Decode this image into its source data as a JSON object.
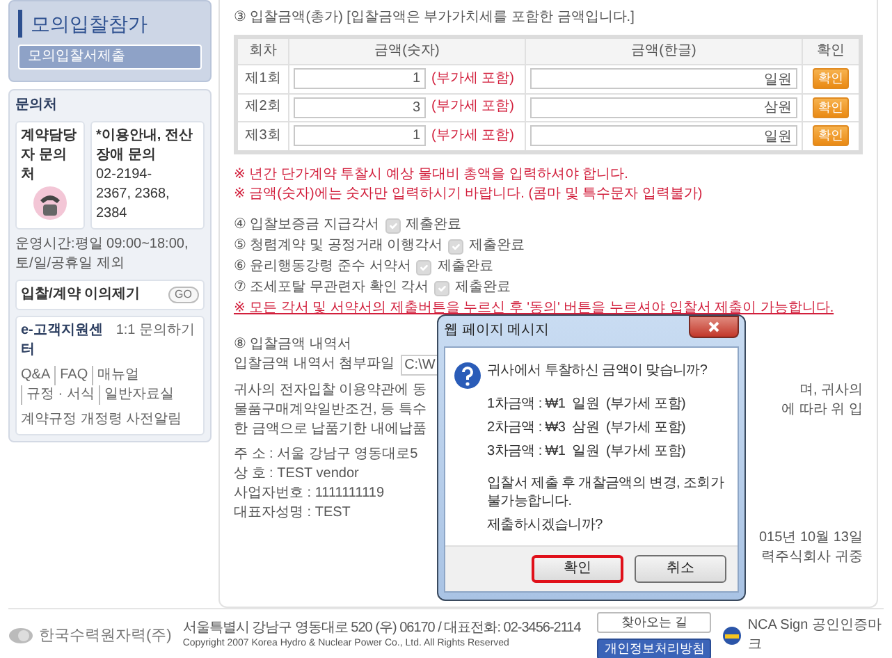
{
  "sidebar": {
    "menu": {
      "title": "모의입찰참가",
      "items": [
        {
          "label": "모의입찰서제출",
          "selected": true
        }
      ]
    },
    "contact": {
      "title": "문의처",
      "contract_contact": "계약담당자 문의처",
      "help_label": "*이용안내, 전산장애 문의",
      "phone_lines": [
        "02-2194-",
        "2367, 2368, 2384"
      ],
      "hours": "운영시간:평일 09:00~18:00, 토/일/공휴일 제외"
    },
    "objection": {
      "label": "입찰/계약 이의제기",
      "button": "GO"
    },
    "support": {
      "title": "e-고객지원센터",
      "inquiry": "1:1 문의하기",
      "link_rows": [
        [
          "Q&A",
          "FAQ",
          "매뉴얼",
          "규정 · 서식",
          "일반자료실"
        ],
        [
          "계약규정 개정령 사전알림"
        ]
      ]
    }
  },
  "main": {
    "bid_amount_heading": "③ 입찰금액(총가) [입찰금액은 부가가치세를 포함한 금액입니다.]",
    "table": {
      "columns": [
        "회차",
        "금액(숫자)",
        "금액(한글)",
        "확인"
      ],
      "rows": [
        {
          "round": "제1회",
          "amount": "1",
          "vat_note": "(부가세 포함)",
          "amount_korean": "일원",
          "button": "확인"
        },
        {
          "round": "제2회",
          "amount": "3",
          "vat_note": "(부가세 포함)",
          "amount_korean": "삼원",
          "button": "확인"
        },
        {
          "round": "제3회",
          "amount": "1",
          "vat_note": "(부가세 포함)",
          "amount_korean": "일원",
          "button": "확인"
        }
      ]
    },
    "notes": [
      "※ 년간 단가계약 투찰시 예상 물대비 총액을 입력하셔야 합니다.",
      "※ 금액(숫자)에는 숫자만 입력하시기 바랍니다. (콤마 및 특수문자 입력불가)"
    ],
    "declarations": [
      {
        "label": "④ 입찰보증금 지급각서",
        "checked": true,
        "status": "제출완료"
      },
      {
        "label": "⑤ 청렴계약 및 공정거래 이행각서",
        "checked": true,
        "status": "제출완료"
      },
      {
        "label": "⑥ 윤리행동강령 준수 서약서",
        "checked": true,
        "status": "제출완료"
      },
      {
        "label": "⑦ 조세포탈 무관련자 확인 각서",
        "checked": true,
        "status": "제출완료"
      }
    ],
    "declaration_note": "※ 모든 각서 및 서약서의 제출버튼을 누르신 후 '동의' 버튼을 누르셔야 입찰서 제출이 가능합니다.",
    "breakdown": {
      "heading": "⑧ 입찰금액 내역서",
      "file_label": "입찰금액 내역서 첨부파일",
      "file_value": "C:\\W"
    },
    "agreement": [
      {
        "left": "귀사의 전자입찰 이용약관에 동",
        "right": "며, 귀사의"
      },
      {
        "left": "물품구매계약일반조건, 등 특수",
        "right": "에 따라 위 입"
      },
      {
        "left": "한 금액으로 납품기한 내에납품"
      }
    ],
    "vendor": [
      "주 소 : 서울 강남구 영동대로5",
      "상 호 : TEST vendor",
      "사업자번호 : 1111111119",
      "대표자성명 : TEST"
    ],
    "closing": [
      "015년 10월 13일",
      "력주식회사 귀중"
    ]
  },
  "dialog": {
    "title": "웹 페이지 메시지",
    "question": "귀사에서 투찰하신 금액이 맞습니까?",
    "amounts": [
      "1차금액 : ₩1  일원  (부가세 포함)",
      "2차금액 : ₩3  삼원  (부가세 포함)",
      "3차금액 : ₩1  일원  (부가세 포함)"
    ],
    "warning": "입찰서 제출 후 개찰금액의 변경, 조회가 불가능합니다.",
    "confirm_question": "제출하시겠습니까?",
    "buttons": [
      {
        "label": "확인",
        "highlighted": true
      },
      {
        "label": "취소",
        "highlighted": false
      }
    ]
  },
  "footer": {
    "logo": "한국수력원자력(주)",
    "address": "서울특별시 강남구 영동대로 520 (우) 06170 / 대표전화: 02-3456-2114",
    "copyright": "Copyright 2007 Korea Hydro & Nuclear Power Co., Ltd. All Rights Reserved",
    "buttons": [
      "찾아오는 길",
      "개인정보처리방침"
    ],
    "cert": "NCA Sign 공인인증마크"
  }
}
